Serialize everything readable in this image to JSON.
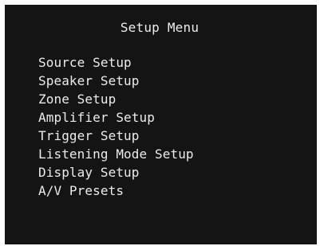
{
  "screen": {
    "title": "Setup Menu",
    "background_color": "#141414",
    "text_color": "#ececec"
  },
  "menu": {
    "items": [
      {
        "label": "Source Setup"
      },
      {
        "label": "Speaker Setup"
      },
      {
        "label": "Zone Setup"
      },
      {
        "label": "Amplifier Setup"
      },
      {
        "label": "Trigger Setup"
      },
      {
        "label": "Listening Mode Setup"
      },
      {
        "label": "Display Setup"
      },
      {
        "label": "A/V Presets"
      }
    ]
  }
}
